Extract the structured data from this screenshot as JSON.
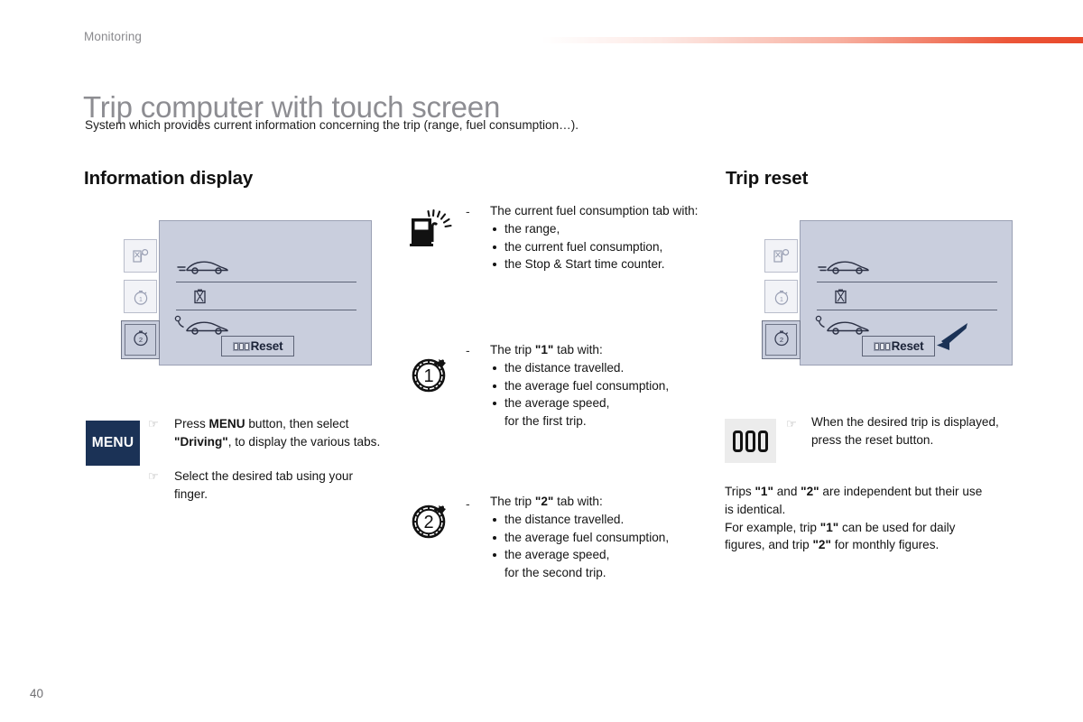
{
  "header": {
    "section_label": "Monitoring",
    "title": "Trip computer with touch screen",
    "intro": "System which provides current information concerning the trip (range, fuel consumption…).",
    "rule_color": "#e8482a"
  },
  "left_column": {
    "heading": "Information display",
    "device": {
      "tabs": [
        {
          "name": "fuel-consumption-tab",
          "selected": false
        },
        {
          "name": "trip-1-tab",
          "selected": false
        },
        {
          "name": "trip-2-tab",
          "selected": true
        }
      ],
      "reset_button_label": "Reset"
    },
    "menu_button_label": "MENU",
    "instructions": [
      "Press MENU button, then select \"Driving\", to display the various tabs.",
      "Select the desired tab using your finger."
    ]
  },
  "middle_column": {
    "items": [
      {
        "icon": "fuel-pump-icon",
        "dash": "-",
        "lead": "The current fuel consumption tab with:",
        "bullets": [
          "the range,",
          "the current fuel consumption,",
          "the Stop & Start time counter."
        ],
        "continuation": ""
      },
      {
        "icon": "stopwatch-1-icon",
        "dash": "-",
        "lead": "The trip \"1\" tab with:",
        "bullets": [
          "the distance travelled.",
          "the average fuel consumption,",
          "the average speed,"
        ],
        "continuation": "for the first trip."
      },
      {
        "icon": "stopwatch-2-icon",
        "dash": "-",
        "lead": "The trip \"2\" tab with:",
        "bullets": [
          "the distance travelled.",
          "the average fuel consumption,",
          "the average speed,"
        ],
        "continuation": "for the second trip."
      }
    ]
  },
  "right_column": {
    "heading": "Trip reset",
    "device": {
      "reset_button_label": "Reset",
      "arrow": "reset-pointer-arrow"
    },
    "odometer_icon": "odometer-reset-icon",
    "instruction": "When the desired trip is displayed, press the reset button.",
    "paragraph_lines": [
      "Trips \"1\" and \"2\" are independent but their use",
      "is identical.",
      "For example, trip \"1\" can be used for daily",
      "figures, and trip \"2\" for monthly figures."
    ]
  },
  "footer": {
    "page_number": "40"
  }
}
